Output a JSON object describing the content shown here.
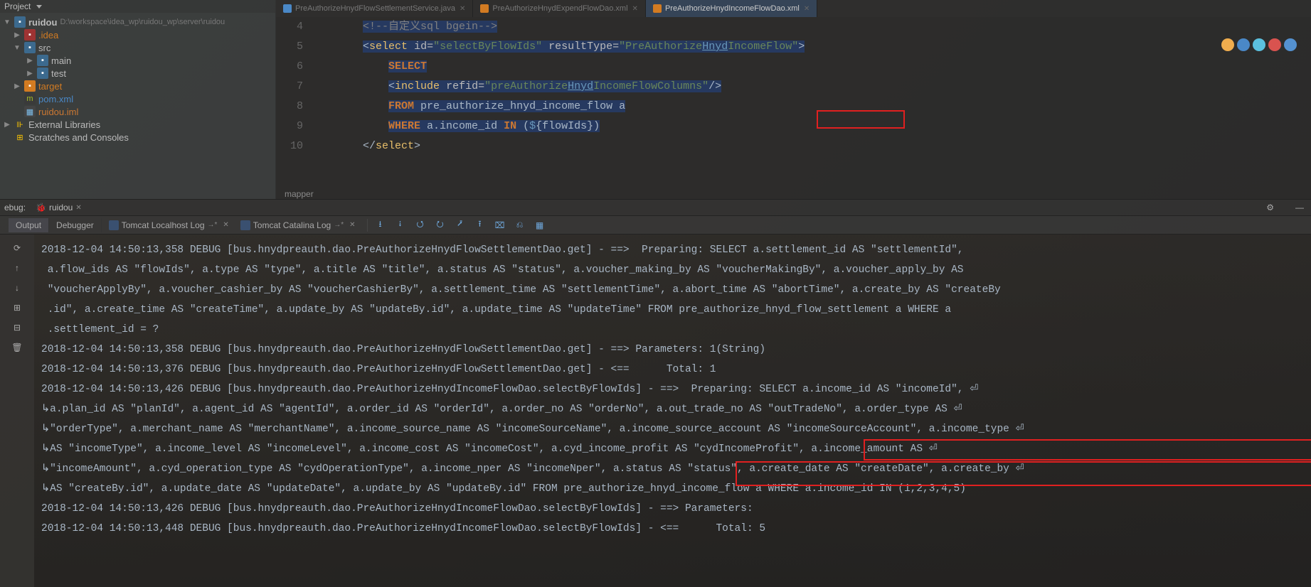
{
  "project": {
    "title": "Project",
    "root": {
      "name": "ruidou",
      "path": "D:\\workspace\\idea_wp\\ruidou_wp\\server\\ruidou"
    },
    "tree": [
      {
        "level": 1,
        "arrow": "▶",
        "iconClass": "folder-red",
        "label": ".idea",
        "labelClass": "highlight"
      },
      {
        "level": 1,
        "arrow": "▼",
        "iconClass": "folder-icon",
        "label": "src"
      },
      {
        "level": 2,
        "arrow": "▶",
        "iconClass": "folder-icon",
        "label": "main"
      },
      {
        "level": 2,
        "arrow": "▶",
        "iconClass": "folder-icon",
        "label": "test"
      },
      {
        "level": 1,
        "arrow": "▶",
        "iconClass": "folder-orange",
        "label": "target",
        "labelClass": "highlight"
      },
      {
        "level": 1,
        "arrow": "",
        "iconClass": "file-xml",
        "iconText": "m",
        "label": "pom.xml",
        "labelColor": "#4a88c7"
      },
      {
        "level": 1,
        "arrow": "",
        "iconClass": "file-iml",
        "iconText": "▦",
        "label": "ruidou.iml",
        "labelColor": "#cc7832"
      },
      {
        "level": 0,
        "arrow": "▶",
        "iconClass": "lib-icon",
        "iconText": "⊪",
        "label": "External Libraries"
      },
      {
        "level": 0,
        "arrow": "",
        "iconClass": "scratch-icon",
        "iconText": "⊞",
        "label": "Scratches and Consoles"
      }
    ]
  },
  "tabs": [
    {
      "label": "PreAuthorizeHnydFlowSettlementService.java",
      "iconColor": "#4a88c7",
      "state": "dim"
    },
    {
      "label": "PreAuthorizeHnydExpendFlowDao.xml",
      "iconColor": "#d27b22",
      "state": "dim"
    },
    {
      "label": "PreAuthorizeHnydIncomeFlowDao.xml",
      "iconColor": "#d27b22",
      "state": "selected"
    }
  ],
  "editor": {
    "lines": [
      {
        "n": 4,
        "html": "        <span class='c-comment sel-bg'>&lt;!--自定义sql bgein--&gt;</span>"
      },
      {
        "n": 5,
        "html": "        <span class='sel-bg'><span class='c-bracket'>&lt;</span><span class='c-tag'>select</span> <span class='c-attr'>id=</span><span class='c-string'>\"selectByFlowIds\"</span> <span class='c-attr'>resultType=</span><span class='c-string'>\"PreAuthorize<span class='c-ref'>Hnyd</span>IncomeFlow\"</span><span class='c-bracket'>&gt;</span></span>"
      },
      {
        "n": 6,
        "html": "            <span class='sel-bg'><span class='c-sql-kw'>SELECT</span></span>"
      },
      {
        "n": 7,
        "html": "            <span class='sel-bg'><span class='c-bracket'>&lt;</span><span class='c-tag'>include</span> <span class='c-attr'>refid=</span><span class='c-string'>\"preAuthorize<span class='c-ref'>Hnyd</span>IncomeFlowColumns\"</span><span class='c-bracket'>/&gt;</span></span>"
      },
      {
        "n": 8,
        "html": "            <span class='sel-bg'><span class='c-sql-kw'>FROM</span> pre_authorize_hnyd_income_flow a</span>"
      },
      {
        "n": 9,
        "html": "            <span class='sel-bg'><span class='c-sql-kw'>WHERE</span> a.income_id <span class='c-sql-kw'>IN</span> (<span style='color:#6897bb'>$</span>{flowIds})</span>"
      },
      {
        "n": 10,
        "html": "        <span class='c-bracket'>&lt;/</span><span class='c-tag'>select</span><span class='c-bracket'>&gt;</span>"
      }
    ],
    "breadcrumb": "mapper"
  },
  "browsers": [
    "#f0ad4e",
    "#4a88c7",
    "#5bc0de",
    "#d9534f",
    "#5491d0"
  ],
  "debug": {
    "label": "ebug:",
    "config": "ruidou",
    "subtabs": [
      "Output",
      "Debugger"
    ],
    "logtabs": [
      {
        "label": "Tomcat Localhost Log"
      },
      {
        "label": "Tomcat Catalina Log"
      }
    ],
    "toolbar_icons": [
      "⭳",
      "⭭",
      "⭯",
      "⭮",
      "⭷",
      "⭱",
      "⌧",
      "⎌",
      "▦"
    ]
  },
  "side_icons": [
    "⟳",
    "↑",
    "↓",
    "⊞",
    "⊟",
    "🗑"
  ],
  "console_lines": [
    "2018-12-04 14:50:13,358 DEBUG [bus.hnydpreauth.dao.PreAuthorizeHnydFlowSettlementDao.get] - ==>  Preparing: SELECT a.settlement_id AS \"settlementId\",",
    " a.flow_ids AS \"flowIds\", a.type AS \"type\", a.title AS \"title\", a.status AS \"status\", a.voucher_making_by AS \"voucherMakingBy\", a.voucher_apply_by AS ",
    " \"voucherApplyBy\", a.voucher_cashier_by AS \"voucherCashierBy\", a.settlement_time AS \"settlementTime\", a.abort_time AS \"abortTime\", a.create_by AS \"createBy",
    " .id\", a.create_time AS \"createTime\", a.update_by AS \"updateBy.id\", a.update_time AS \"updateTime\" FROM pre_authorize_hnyd_flow_settlement a WHERE a",
    " .settlement_id = ? ",
    "2018-12-04 14:50:13,358 DEBUG [bus.hnydpreauth.dao.PreAuthorizeHnydFlowSettlementDao.get] - ==> Parameters: 1(String)",
    "2018-12-04 14:50:13,376 DEBUG [bus.hnydpreauth.dao.PreAuthorizeHnydFlowSettlementDao.get] - <==      Total: 1",
    "2018-12-04 14:50:13,426 DEBUG [bus.hnydpreauth.dao.PreAuthorizeHnydIncomeFlowDao.selectByFlowIds] - ==>  Preparing: SELECT a.income_id AS \"incomeId\", ⏎",
    "↳a.plan_id AS \"planId\", a.agent_id AS \"agentId\", a.order_id AS \"orderId\", a.order_no AS \"orderNo\", a.out_trade_no AS \"outTradeNo\", a.order_type AS ⏎",
    "↳\"orderType\", a.merchant_name AS \"merchantName\", a.income_source_name AS \"incomeSourceName\", a.income_source_account AS \"incomeSourceAccount\", a.income_type ⏎",
    "↳AS \"incomeType\", a.income_level AS \"incomeLevel\", a.income_cost AS \"incomeCost\", a.cyd_income_profit AS \"cydIncomeProfit\", a.income_amount AS ⏎",
    "↳\"incomeAmount\", a.cyd_operation_type AS \"cydOperationType\", a.income_nper AS \"incomeNper\", a.status AS \"status\", a.create_date AS \"createDate\", a.create_by ⏎",
    "↳AS \"createBy.id\", a.update_date AS \"updateDate\", a.update_by AS \"updateBy.id\" FROM pre_authorize_hnyd_income_flow a WHERE a.income_id IN (1,2,3,4,5) ",
    "2018-12-04 14:50:13,426 DEBUG [bus.hnydpreauth.dao.PreAuthorizeHnydIncomeFlowDao.selectByFlowIds] - ==> Parameters: ",
    "2018-12-04 14:50:13,448 DEBUG [bus.hnydpreauth.dao.PreAuthorizeHnydIncomeFlowDao.selectByFlowIds] - <==      Total: 5"
  ]
}
